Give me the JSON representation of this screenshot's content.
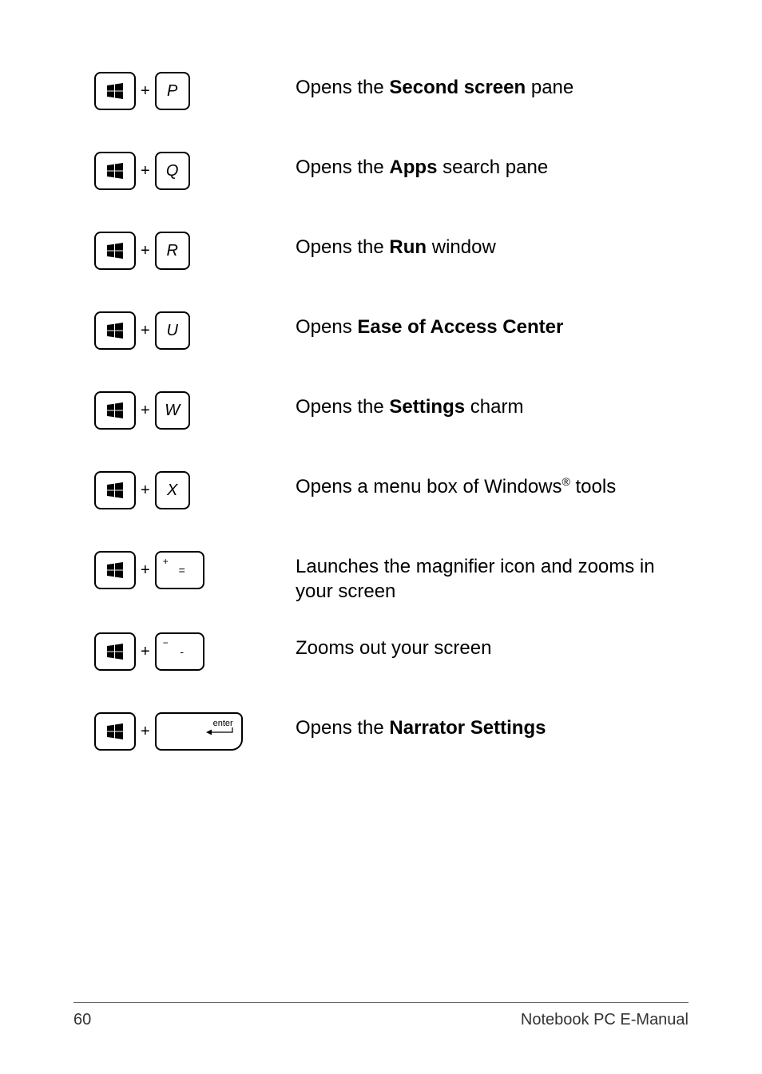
{
  "shortcuts": [
    {
      "key2_type": "letter",
      "key2_label": "P",
      "desc_parts": [
        "Opens the ",
        "Second screen",
        " pane"
      ],
      "bold_index": 1,
      "tight": false
    },
    {
      "key2_type": "letter",
      "key2_label": "Q",
      "desc_parts": [
        "Opens the ",
        "Apps",
        " search pane"
      ],
      "bold_index": 1,
      "tight": false
    },
    {
      "key2_type": "letter",
      "key2_label": "R",
      "desc_parts": [
        "Opens the ",
        "Run",
        " window"
      ],
      "bold_index": 1,
      "tight": false
    },
    {
      "key2_type": "letter",
      "key2_label": "U",
      "desc_parts": [
        "Opens ",
        "Ease of Access Center",
        ""
      ],
      "bold_index": 1,
      "tight": false
    },
    {
      "key2_type": "letter",
      "key2_label": "W",
      "desc_parts": [
        "Opens the ",
        "Settings",
        " charm"
      ],
      "bold_index": 1,
      "tight": false
    },
    {
      "key2_type": "letter",
      "key2_label": "X",
      "desc_parts": [
        "Opens a menu box of Windows",
        "®",
        " tools"
      ],
      "bold_index": -1,
      "reg_index": 1,
      "tight": false
    },
    {
      "key2_type": "plus_equals",
      "key2_top": "+",
      "key2_center": "=",
      "desc_parts": [
        "Launches the magnifier icon and zooms in your screen"
      ],
      "bold_index": -1,
      "tight": true
    },
    {
      "key2_type": "minus_dash",
      "key2_top": "−",
      "key2_center": "-",
      "desc_parts": [
        "Zooms out your screen"
      ],
      "bold_index": -1,
      "tight": false
    },
    {
      "key2_type": "enter",
      "key2_label": "enter",
      "desc_parts": [
        "Opens the ",
        "Narrator Settings",
        ""
      ],
      "bold_index": 1,
      "tight": false
    }
  ],
  "plus": "+",
  "footer": {
    "page": "60",
    "title": "Notebook PC E-Manual"
  }
}
